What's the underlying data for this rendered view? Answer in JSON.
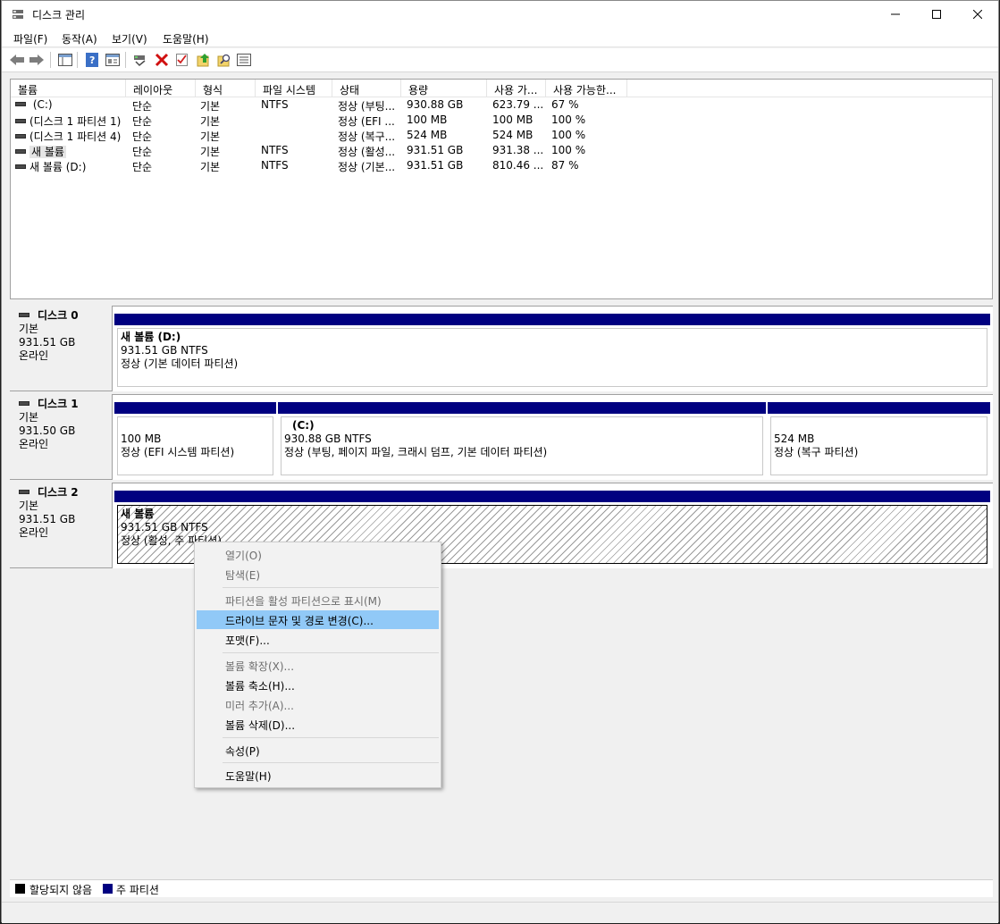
{
  "window": {
    "title": "디스크 관리"
  },
  "menubar": [
    "파일(F)",
    "동작(A)",
    "보기(V)",
    "도움말(H)"
  ],
  "toolbar": {
    "buttons": [
      "back-icon",
      "forward-icon",
      "console-tree-icon",
      "help-icon",
      "properties-icon",
      "connect-icon",
      "delete-icon",
      "check-icon",
      "export-up-icon",
      "search-icon",
      "list-view-icon"
    ]
  },
  "columns": [
    "볼륨",
    "레이아웃",
    "형식",
    "파일 시스템",
    "상태",
    "용량",
    "사용 가...",
    "사용 가능한..."
  ],
  "volumes": [
    {
      "name": " (C:)",
      "layout": "단순",
      "type": "기본",
      "fs": "NTFS",
      "status": "정상 (부팅...",
      "capacity": "930.88 GB",
      "free": "623.79 ...",
      "pct": "67 %"
    },
    {
      "name": "(디스크 1 파티션 1)",
      "layout": "단순",
      "type": "기본",
      "fs": "",
      "status": "정상 (EFI ...",
      "capacity": "100 MB",
      "free": "100 MB",
      "pct": "100 %"
    },
    {
      "name": "(디스크 1 파티션 4)",
      "layout": "단순",
      "type": "기본",
      "fs": "",
      "status": "정상 (복구...",
      "capacity": "524 MB",
      "free": "524 MB",
      "pct": "100 %"
    },
    {
      "name": "새 볼륨",
      "layout": "단순",
      "type": "기본",
      "fs": "NTFS",
      "status": "정상 (활성...",
      "capacity": "931.51 GB",
      "free": "931.38 ...",
      "pct": "100 %"
    },
    {
      "name": "새 볼륨 (D:)",
      "layout": "단순",
      "type": "기본",
      "fs": "NTFS",
      "status": "정상 (기본...",
      "capacity": "931.51 GB",
      "free": "810.46 ...",
      "pct": "87 %"
    }
  ],
  "disks": [
    {
      "name": "디스크 0",
      "type": "기본",
      "size": "931.51 GB",
      "state": "온라인",
      "partitions": [
        {
          "name": "새 볼륨  (D:)",
          "size": "931.51 GB NTFS",
          "status": "정상 (기본 데이터 파티션)"
        }
      ]
    },
    {
      "name": "디스크 1",
      "type": "기본",
      "size": "931.50 GB",
      "state": "온라인",
      "partitions": [
        {
          "name": "",
          "size": "100 MB",
          "status": "정상 (EFI 시스템 파티션)"
        },
        {
          "name": "(C:)",
          "size": "930.88 GB NTFS",
          "status": "정상 (부팅, 페이지 파일, 크래시 덤프, 기본 데이터 파티션)"
        },
        {
          "name": "",
          "size": "524 MB",
          "status": "정상 (복구 파티션)"
        }
      ]
    },
    {
      "name": "디스크 2",
      "type": "기본",
      "size": "931.51 GB",
      "state": "온라인",
      "partitions": [
        {
          "name": "새 볼륨",
          "size": "931.51 GB NTFS",
          "status": "정상 (활성, 주 파티션)"
        }
      ]
    }
  ],
  "legend": [
    {
      "label": "할당되지 않음",
      "color": "#000000"
    },
    {
      "label": "주 파티션",
      "color": "#000080"
    }
  ],
  "context_menu": {
    "items": [
      {
        "label": "열기(O)",
        "disabled": true
      },
      {
        "label": "탐색(E)",
        "disabled": true
      },
      {
        "label": "파티션을 활성 파티션으로 표시(M)",
        "disabled": true
      },
      {
        "label": "드라이브 문자 및 경로 변경(C)...",
        "disabled": false,
        "highlighted": true
      },
      {
        "label": "포맷(F)...",
        "disabled": false
      },
      {
        "label": "볼륨 확장(X)...",
        "disabled": true
      },
      {
        "label": "볼륨 축소(H)...",
        "disabled": false
      },
      {
        "label": "미러 추가(A)...",
        "disabled": true
      },
      {
        "label": "볼륨 삭제(D)...",
        "disabled": false
      },
      {
        "label": "속성(P)",
        "disabled": false
      },
      {
        "label": "도움말(H)",
        "disabled": false
      }
    ]
  },
  "colors": {
    "primary_partition": "#000080",
    "menu_highlight": "#91c9f7"
  }
}
